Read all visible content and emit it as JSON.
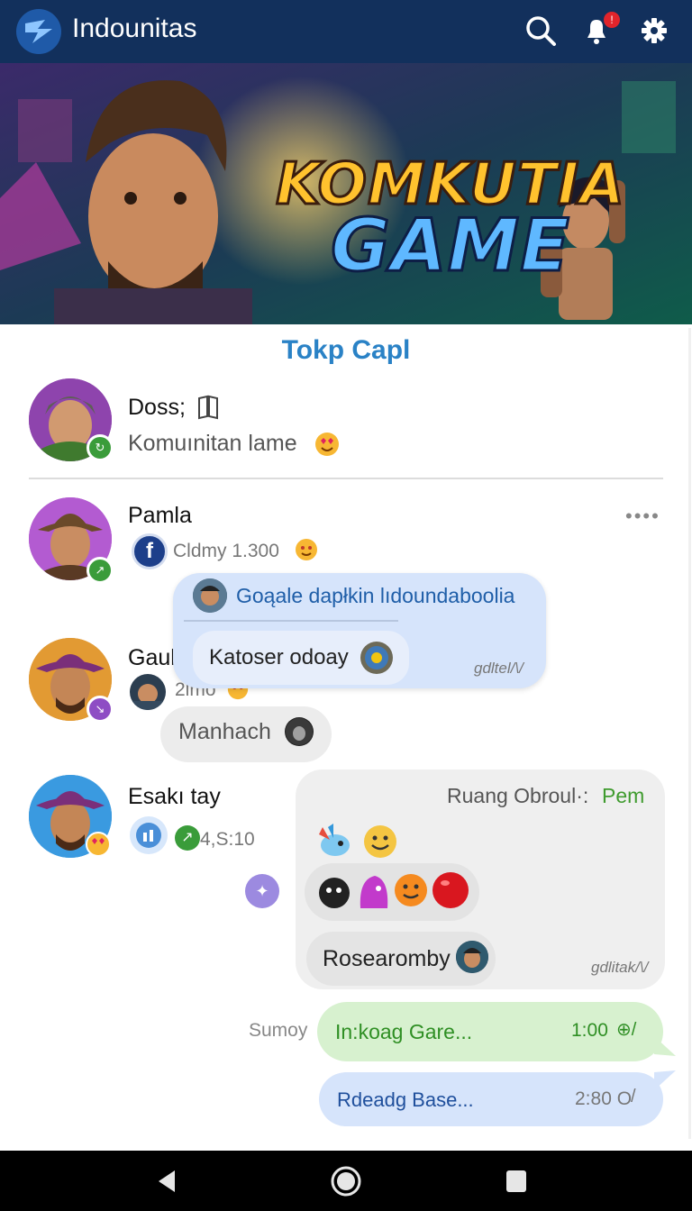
{
  "app": {
    "title": "Indounitas",
    "notification_count": "!"
  },
  "header_icons": [
    "search-icon",
    "notification-icon",
    "settings-icon"
  ],
  "banner": {
    "line1": "KOMKUTIA",
    "line2": "GAME"
  },
  "section_title": "Tokp Capl",
  "pinned": {
    "name": "Doss;",
    "message": "Komuınitan lame"
  },
  "chats": [
    {
      "name": "Pamla",
      "meta": "Cldmy  1.300"
    },
    {
      "name": "Gaultu",
      "meta": "2lmo",
      "reply": "Manhach"
    },
    {
      "name": "Esakı tay",
      "meta": "4,S:10"
    }
  ],
  "popup": {
    "header": "Goąale dapłkin lıdoundaboolia",
    "message": "Katoser odoay",
    "stamp": "gdltel/\\/"
  },
  "group_message": {
    "title_prefix": "Ruang Obroul·:",
    "title_accent": "Pem",
    "footer": "Rosearomby",
    "stamp": "gdlitak/\\/"
  },
  "sent": {
    "label": "Sumoy",
    "messages": [
      {
        "text": "In:koag Gare...",
        "time": "1:00"
      },
      {
        "text": "Rdeadg Base...",
        "time": "2:80 O"
      }
    ]
  },
  "colors": {
    "appbar": "#12305c",
    "accent_blue": "#2a82c6",
    "bubble_blue": "#d6e4fb",
    "bubble_green": "#d7f1cf",
    "bubble_gray": "#efefef",
    "green_text": "#3f9b2e"
  }
}
